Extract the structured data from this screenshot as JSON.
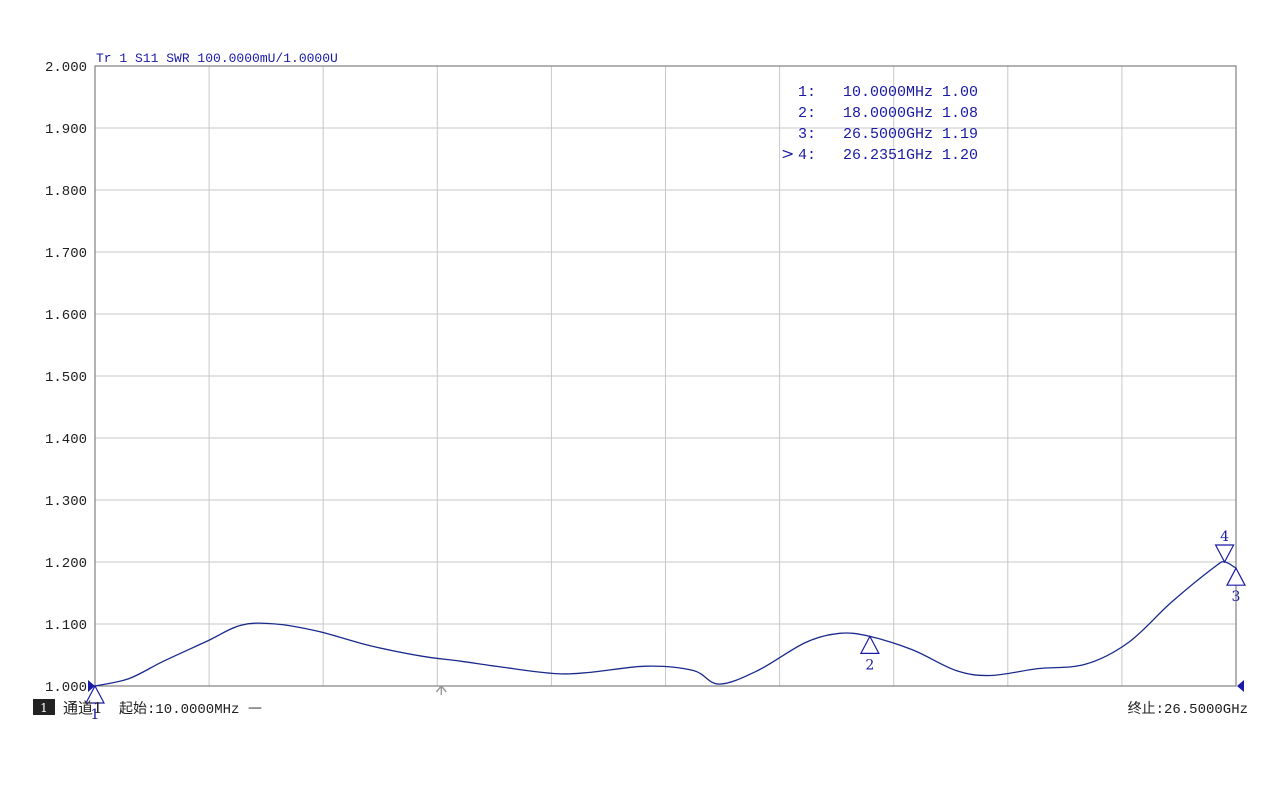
{
  "trace_label": "Tr 1  S11 SWR 100.0000mU/1.0000U",
  "channel_badge": "1",
  "channel_label": "通道1",
  "start_label": "起始:10.0000MHz",
  "start_dash": "—",
  "stop_label": "终止:26.5000GHz",
  "colors": {
    "trace": "#1a2a8c",
    "marker_text": "#1a1aa8",
    "grid": "#c8c8c8",
    "frame": "#808080",
    "axis_text": "#202020"
  },
  "markers": [
    {
      "id": "1",
      "prefix": " ",
      "freq": "10.0000MHz",
      "value": "1.00"
    },
    {
      "id": "2",
      "prefix": " ",
      "freq": "18.0000GHz",
      "value": "1.08"
    },
    {
      "id": "3",
      "prefix": " ",
      "freq": "26.5000GHz",
      "value": "1.19"
    },
    {
      "id": "4",
      "prefix": ">",
      "freq": "26.2351GHz",
      "value": "1.20"
    }
  ],
  "chart_data": {
    "type": "line",
    "title": "",
    "xlabel": "",
    "ylabel": "",
    "ylim": [
      1.0,
      2.0
    ],
    "xlim_ghz": [
      0.01,
      26.5
    ],
    "y_ticks": [
      "2.000",
      "1.900",
      "1.800",
      "1.700",
      "1.600",
      "1.500",
      "1.400",
      "1.300",
      "1.200",
      "1.100",
      "1.000"
    ],
    "grid": true,
    "series": [
      {
        "x_ghz": [
          0.01,
          0.8,
          1.6,
          2.6,
          3.4,
          4.2,
          5.2,
          6.4,
          7.6,
          8.5,
          9.5,
          10.7,
          11.5,
          12.8,
          13.9,
          14.5,
          15.4,
          16.5,
          17.3,
          18.0,
          19.0,
          20.0,
          20.8,
          21.9,
          23.0,
          24.0,
          25.0,
          26.0,
          26.24,
          26.5
        ],
        "y": [
          1.0,
          1.012,
          1.04,
          1.072,
          1.098,
          1.1,
          1.088,
          1.065,
          1.048,
          1.04,
          1.03,
          1.02,
          1.022,
          1.032,
          1.025,
          1.003,
          1.025,
          1.07,
          1.085,
          1.08,
          1.058,
          1.025,
          1.017,
          1.028,
          1.035,
          1.07,
          1.135,
          1.192,
          1.2,
          1.19
        ]
      }
    ]
  }
}
